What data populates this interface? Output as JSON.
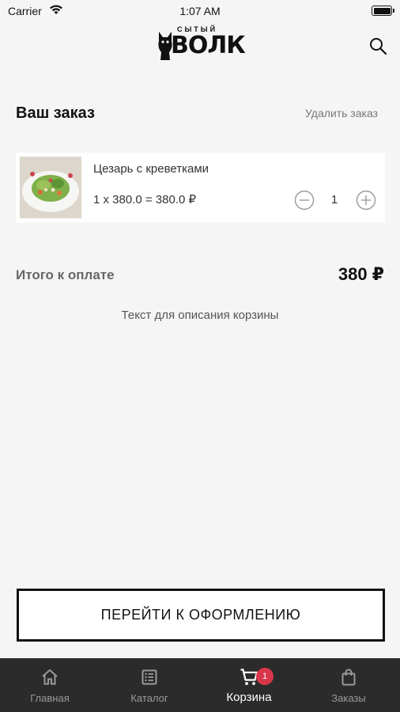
{
  "status_bar": {
    "carrier": "Carrier",
    "time": "1:07 AM"
  },
  "header": {
    "logo_small": "СЫТЫЙ",
    "logo_big": "ВОЛК",
    "search_icon": "search-icon"
  },
  "order": {
    "title": "Ваш заказ",
    "delete_label": "Удалить заказ"
  },
  "cart_items": [
    {
      "name": "Цезарь с креветками",
      "price_line": "1 x 380.0 = 380.0 ₽",
      "quantity": "1"
    }
  ],
  "summary": {
    "total_label": "Итого к оплате",
    "total_value": "380 ₽",
    "description": "Текст для описания корзины"
  },
  "checkout": {
    "label": "ПЕРЕЙТИ К ОФОРМЛЕНИЮ"
  },
  "tab_bar": {
    "tabs": [
      {
        "label": "Главная",
        "icon": "home-icon",
        "active": false
      },
      {
        "label": "Каталог",
        "icon": "catalog-icon",
        "active": false
      },
      {
        "label": "Корзина",
        "icon": "cart-icon",
        "active": true,
        "badge": "1"
      },
      {
        "label": "Заказы",
        "icon": "bag-icon",
        "active": false
      }
    ]
  },
  "colors": {
    "background": "#f5f5f5",
    "tab_bar": "#2b2b2b",
    "badge": "#d8364a",
    "inactive_tab": "#9a9a9a"
  }
}
